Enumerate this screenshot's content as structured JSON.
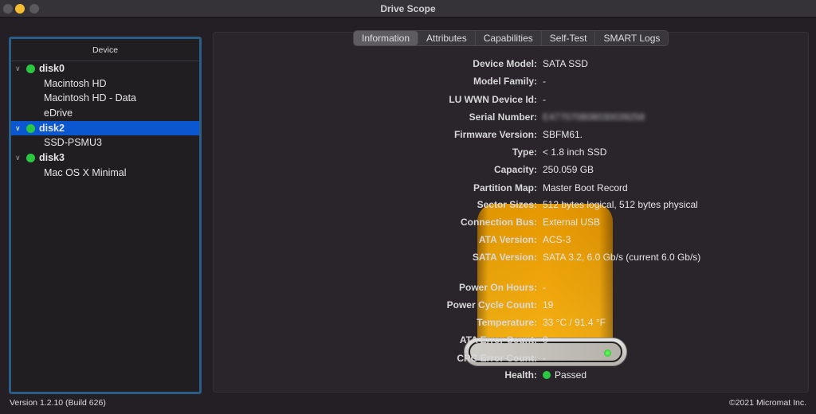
{
  "window": {
    "title": "Drive Scope"
  },
  "sidebar": {
    "header": "Device",
    "items": [
      {
        "type": "disk",
        "label": "disk0",
        "status": "green"
      },
      {
        "type": "volume",
        "label": "Macintosh HD"
      },
      {
        "type": "volume",
        "label": "Macintosh HD - Data"
      },
      {
        "type": "volume",
        "label": "eDrive"
      },
      {
        "type": "disk",
        "label": "disk2",
        "status": "green",
        "selected": true
      },
      {
        "type": "volume",
        "label": "SSD-PSMU3"
      },
      {
        "type": "disk",
        "label": "disk3",
        "status": "green"
      },
      {
        "type": "volume",
        "label": "Mac OS X Minimal"
      }
    ]
  },
  "tabs": [
    {
      "label": "Information",
      "active": true
    },
    {
      "label": "Attributes"
    },
    {
      "label": "Capabilities"
    },
    {
      "label": "Self-Test"
    },
    {
      "label": "SMART Logs"
    }
  ],
  "info": [
    {
      "label": "Device Model:",
      "value": "SATA SSD"
    },
    {
      "label": "Model Family:",
      "value": "-"
    },
    {
      "label": "LU WWN Device Id:",
      "value": "-"
    },
    {
      "label": "Serial Number:",
      "value": "E477070808030039258",
      "blurred": true
    },
    {
      "label": "Firmware Version:",
      "value": "SBFM61."
    },
    {
      "label": "Type:",
      "value": "< 1.8 inch SSD"
    },
    {
      "label": "Capacity:",
      "value": "250.059 GB"
    },
    {
      "label": "Partition Map:",
      "value": "Master Boot Record"
    },
    {
      "label": "Sector Sizes:",
      "value": "512 bytes logical, 512 bytes physical"
    },
    {
      "label": "Connection Bus:",
      "value": "External USB"
    },
    {
      "label": "ATA Version:",
      "value": "ACS-3"
    },
    {
      "label": "SATA Version:",
      "value": "SATA 3.2, 6.0 Gb/s (current 6.0 Gb/s)"
    },
    {
      "label": "Power On Hours:",
      "value": "-"
    },
    {
      "label": "Power Cycle Count:",
      "value": "19"
    },
    {
      "label": "Temperature:",
      "value": "33 °C / 91.4 °F"
    },
    {
      "label": "ATA Error Count:",
      "value": "0"
    },
    {
      "label": "CRC Error Count:",
      "value": "-"
    },
    {
      "label": "Health:",
      "value": "Passed",
      "status": "green"
    }
  ],
  "footer": {
    "version": "Version 1.2.10 (Build 626)",
    "copyright": "©2021 Micromat Inc."
  },
  "colors": {
    "accent": "#0b57d0",
    "status_green": "#2ac840",
    "drive": "#f2a600"
  }
}
